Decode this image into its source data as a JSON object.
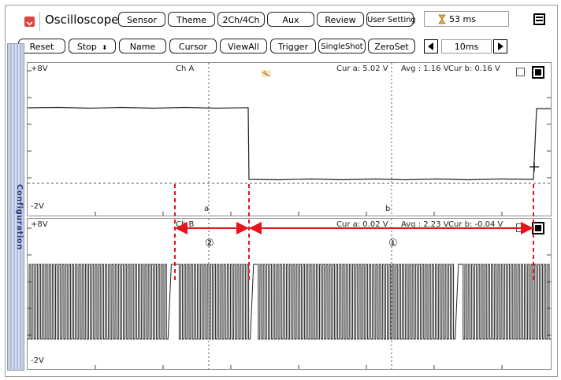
{
  "app": {
    "title": "Oscilloscope"
  },
  "toolbar_top": {
    "buttons": [
      "Sensor",
      "Theme",
      "2Ch/4Ch",
      "Aux",
      "Review",
      "User Setting"
    ],
    "timer": "53 ms"
  },
  "toolbar_bottom": {
    "buttons": [
      "Reset",
      "Stop",
      "Name",
      "Cursor",
      "ViewAll",
      "Trigger",
      "SingleShot",
      "ZeroSet"
    ],
    "timebase": "10ms"
  },
  "sidebar": {
    "label": "Configuration"
  },
  "channel_a": {
    "name": "Ch A",
    "max_label": "+8V",
    "min_label": "-2V",
    "cur_a": "Cur a: 5.02 V",
    "avg": "Avg : 1.16 V",
    "cur_b": "Cur b: 0.16 V",
    "cursor_a": "a",
    "cursor_b": "b"
  },
  "channel_b": {
    "name": "Ch B",
    "max_label": "+8V",
    "min_label": "-2V",
    "cur_a": "Cur a: 0.02 V",
    "avg": "Avg : 2.23 V",
    "cur_b": "Cur b: -0.04 V"
  },
  "annotations": {
    "marker_1": "①",
    "marker_2": "②"
  },
  "colors": {
    "annotation": "#e8141b",
    "sidebar": "#c6cfe4",
    "sidebar_text": "#263a78",
    "app_icon": "#d9443f"
  },
  "icons": {
    "app": "app-logo-icon",
    "timer": "hourglass-icon",
    "window": "window-toggle-icon"
  }
}
